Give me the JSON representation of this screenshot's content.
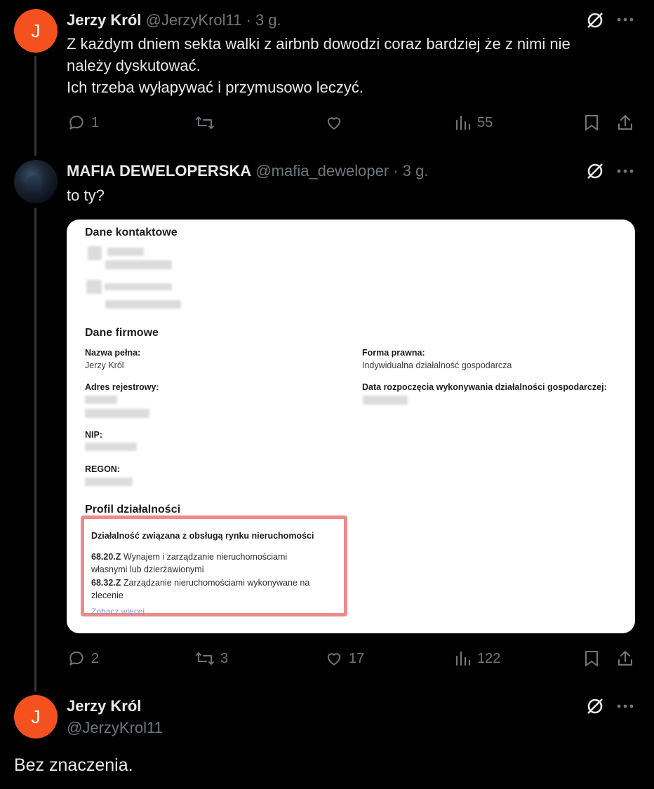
{
  "tweet1": {
    "avatar_letter": "J",
    "name": "Jerzy Król",
    "handle": "@JerzyKrol11",
    "time": "· 3 g.",
    "lines": [
      "Z każdym dniem sekta walki z airbnb dowodzi coraz bardziej że z nimi nie",
      "należy dyskutować.",
      "Ich trzeba wyłapywać i przymusowo leczyć."
    ],
    "replies": "1",
    "reposts": "",
    "likes": "",
    "views": "55"
  },
  "tweet2": {
    "name": "MAFIA DEWELOPERSKA",
    "handle": "@mafia_deweloper",
    "time": "· 3 g.",
    "text": "to ty?",
    "replies": "2",
    "reposts": "3",
    "likes": "17",
    "views": "122",
    "card": {
      "contact_title": "Dane kontaktowe",
      "company_title": "Dane firmowe",
      "full_name_label": "Nazwa pełna:",
      "full_name_value": "Jerzy Król",
      "legal_form_label": "Forma prawna:",
      "legal_form_value": "Indywidualna działalność gospodarcza",
      "address_label": "Adres rejestrowy:",
      "start_date_label": "Data rozpoczęcia wykonywania działalności gospodarczej:",
      "nip_label": "NIP:",
      "regon_label": "REGON:",
      "profile_title": "Profil działalności",
      "activity_title": "Działalność związana z obsługą rynku nieruchomości",
      "code1": "68.20.Z",
      "code1_text_a": "Wynajem i zarządzanie nieruchomościami",
      "code1_text_b": "własnymi lub dzierżawionymi",
      "code2": "68.32.Z",
      "code2_text_a": "Zarządzanie nieruchomościami wykonywane na",
      "code2_text_b": "zlecenie",
      "see_more": "Zobacz więcej"
    }
  },
  "tweet3": {
    "avatar_letter": "J",
    "name": "Jerzy Król",
    "handle": "@JerzyKrol11",
    "text": "Bez znaczenia."
  },
  "colors": {
    "background": "#000000",
    "text": "#e7e9ea",
    "muted": "#71767b",
    "avatar_orange": "#f4511e",
    "highlight_border": "#ee8a8a"
  }
}
